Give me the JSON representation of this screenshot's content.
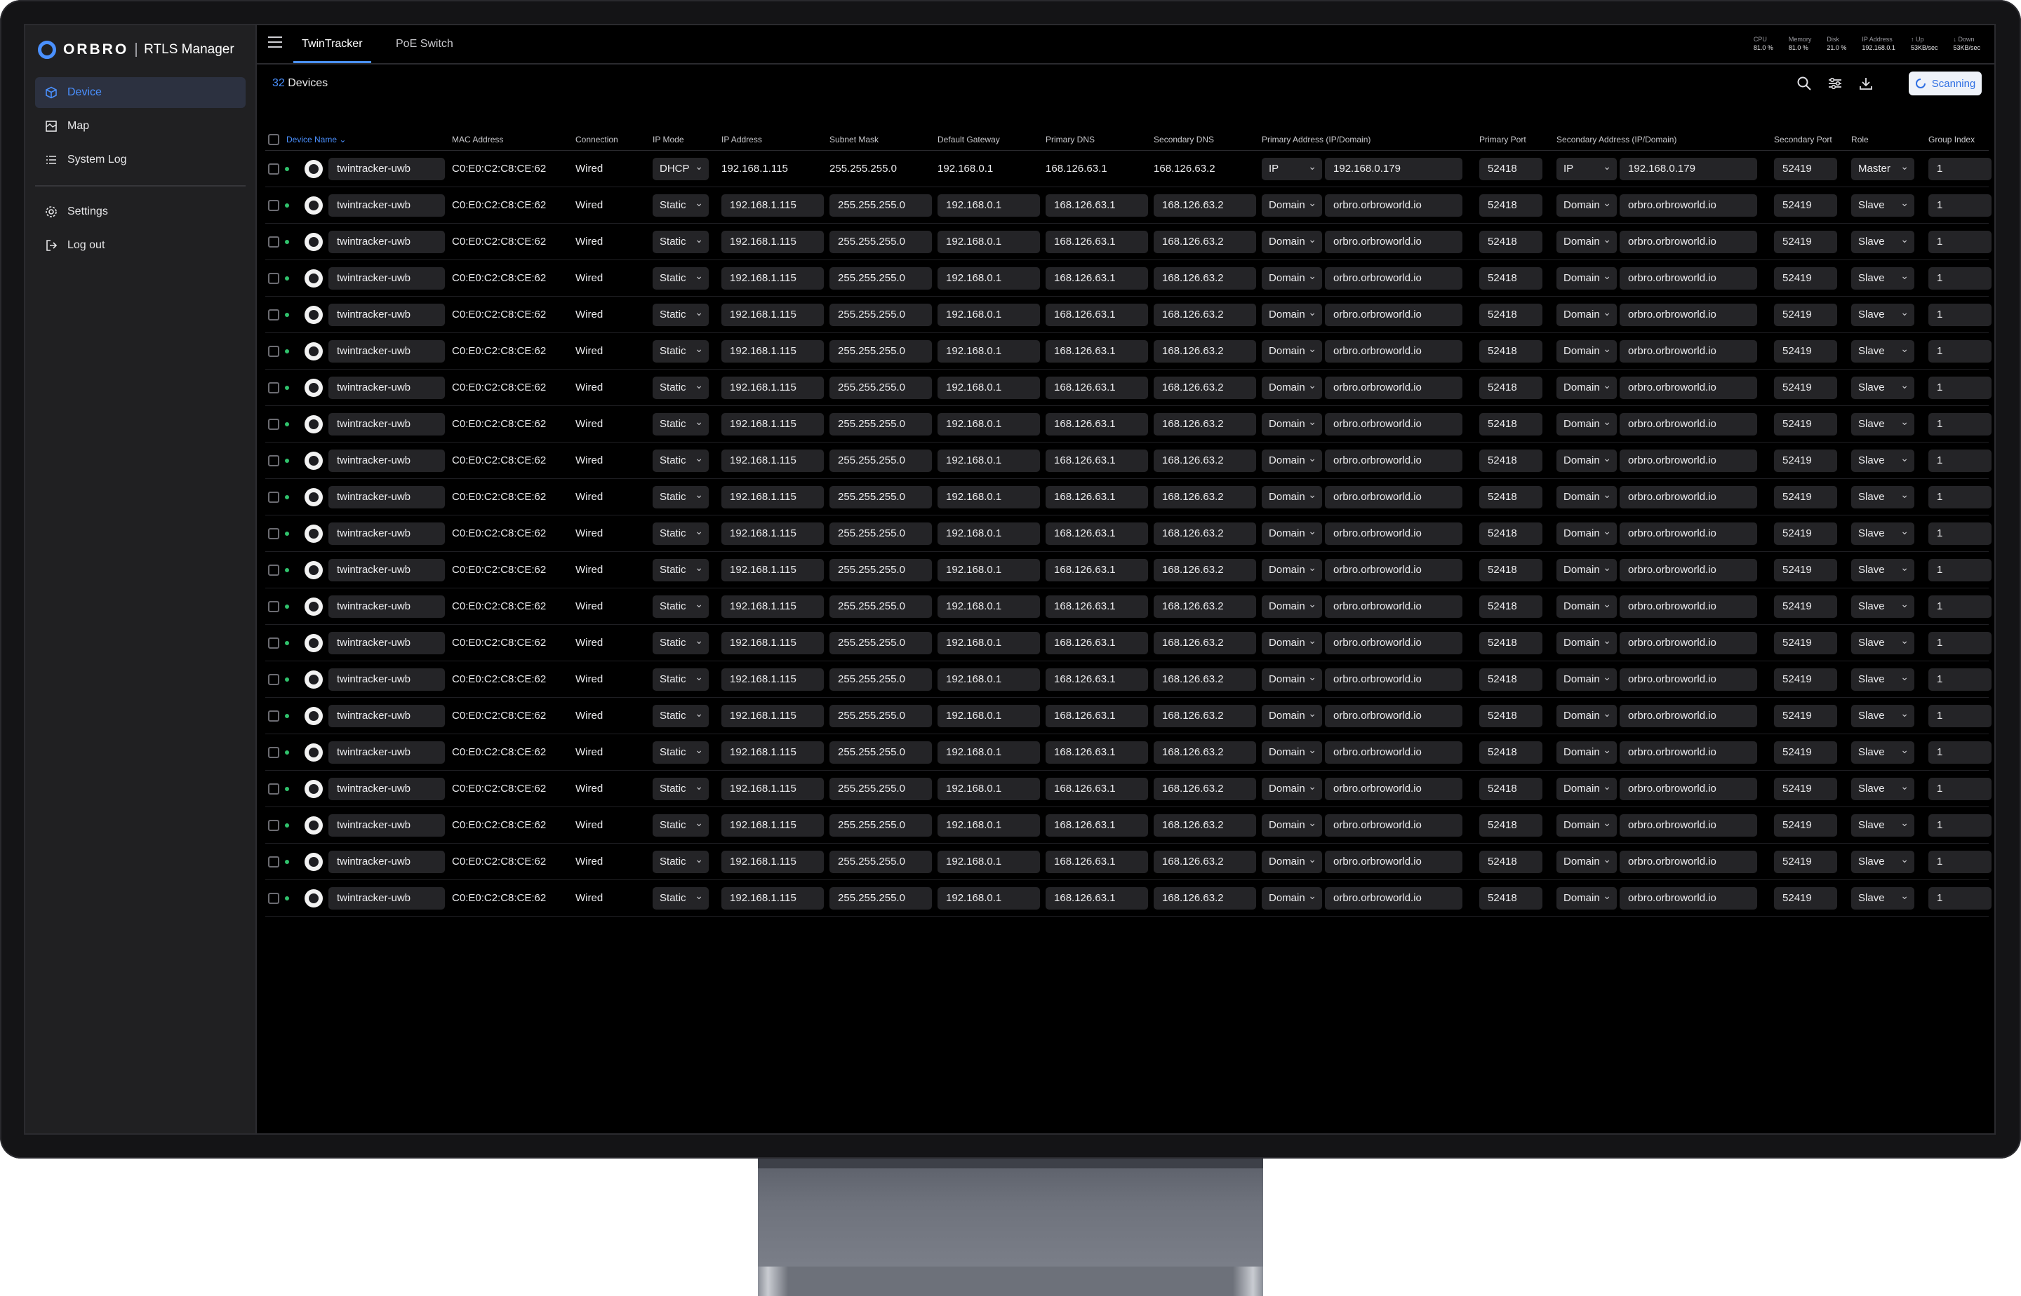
{
  "app": {
    "brand": "ORBRO",
    "product": "RTLS Manager"
  },
  "sidebar": {
    "items": [
      {
        "label": "Device",
        "icon": "cube-icon",
        "active": true
      },
      {
        "label": "Map",
        "icon": "map-icon"
      },
      {
        "label": "System Log",
        "icon": "list-icon"
      }
    ],
    "bottom_items": [
      {
        "label": "Settings",
        "icon": "gear-icon"
      },
      {
        "label": "Log out",
        "icon": "logout-icon"
      }
    ]
  },
  "tabs": [
    {
      "label": "TwinTracker",
      "active": true
    },
    {
      "label": "PoE Switch"
    }
  ],
  "stats": [
    {
      "label": "CPU",
      "value": "81.0 %"
    },
    {
      "label": "Memory",
      "value": "81.0 %"
    },
    {
      "label": "Disk",
      "value": "21.0 %"
    },
    {
      "label": "IP Address",
      "value": "192.168.0.1"
    },
    {
      "label": "↑ Up",
      "value": "53KB/sec"
    },
    {
      "label": "↓ Down",
      "value": "53KB/sec"
    }
  ],
  "toolbar": {
    "count": "32",
    "count_label": "Devices",
    "scan_label": "Scanning"
  },
  "columns": [
    "Device Name",
    "MAC Address",
    "Connection",
    "IP Mode",
    "IP Address",
    "Subnet Mask",
    "Default Gateway",
    "Primary DNS",
    "Secondary DNS",
    "Primary Address (IP/Domain)",
    "Primary Port",
    "Secondary Address (IP/Domain)",
    "Secondary Port",
    "Role",
    "Group Index"
  ],
  "rows": [
    {
      "name": "twintracker-uwb",
      "mac": "C0:E0:C2:C8:CE:62",
      "conn": "Wired",
      "mode": "DHCP",
      "ip": "192.168.1.115",
      "mask": "255.255.255.0",
      "gw": "192.168.0.1",
      "dns1": "168.126.63.1",
      "dns2": "168.126.63.2",
      "paddr_type": "IP",
      "paddr": "192.168.0.179",
      "pport": "52418",
      "saddr_type": "IP",
      "saddr": "192.168.0.179",
      "sport": "52419",
      "role": "Master",
      "group": "1"
    },
    {
      "name": "twintracker-uwb",
      "mac": "C0:E0:C2:C8:CE:62",
      "conn": "Wired",
      "mode": "Static",
      "ip": "192.168.1.115",
      "mask": "255.255.255.0",
      "gw": "192.168.0.1",
      "dns1": "168.126.63.1",
      "dns2": "168.126.63.2",
      "paddr_type": "Domain",
      "paddr": "orbro.orbroworld.io",
      "pport": "52418",
      "saddr_type": "Domain",
      "saddr": "orbro.orbroworld.io",
      "sport": "52419",
      "role": "Slave",
      "group": "1"
    },
    {
      "name": "twintracker-uwb",
      "mac": "C0:E0:C2:C8:CE:62",
      "conn": "Wired",
      "mode": "Static",
      "ip": "192.168.1.115",
      "mask": "255.255.255.0",
      "gw": "192.168.0.1",
      "dns1": "168.126.63.1",
      "dns2": "168.126.63.2",
      "paddr_type": "Domain",
      "paddr": "orbro.orbroworld.io",
      "pport": "52418",
      "saddr_type": "Domain",
      "saddr": "orbro.orbroworld.io",
      "sport": "52419",
      "role": "Slave",
      "group": "1"
    },
    {
      "name": "twintracker-uwb",
      "mac": "C0:E0:C2:C8:CE:62",
      "conn": "Wired",
      "mode": "Static",
      "ip": "192.168.1.115",
      "mask": "255.255.255.0",
      "gw": "192.168.0.1",
      "dns1": "168.126.63.1",
      "dns2": "168.126.63.2",
      "paddr_type": "Domain",
      "paddr": "orbro.orbroworld.io",
      "pport": "52418",
      "saddr_type": "Domain",
      "saddr": "orbro.orbroworld.io",
      "sport": "52419",
      "role": "Slave",
      "group": "1"
    },
    {
      "name": "twintracker-uwb",
      "mac": "C0:E0:C2:C8:CE:62",
      "conn": "Wired",
      "mode": "Static",
      "ip": "192.168.1.115",
      "mask": "255.255.255.0",
      "gw": "192.168.0.1",
      "dns1": "168.126.63.1",
      "dns2": "168.126.63.2",
      "paddr_type": "Domain",
      "paddr": "orbro.orbroworld.io",
      "pport": "52418",
      "saddr_type": "Domain",
      "saddr": "orbro.orbroworld.io",
      "sport": "52419",
      "role": "Slave",
      "group": "1"
    },
    {
      "name": "twintracker-uwb",
      "mac": "C0:E0:C2:C8:CE:62",
      "conn": "Wired",
      "mode": "Static",
      "ip": "192.168.1.115",
      "mask": "255.255.255.0",
      "gw": "192.168.0.1",
      "dns1": "168.126.63.1",
      "dns2": "168.126.63.2",
      "paddr_type": "Domain",
      "paddr": "orbro.orbroworld.io",
      "pport": "52418",
      "saddr_type": "Domain",
      "saddr": "orbro.orbroworld.io",
      "sport": "52419",
      "role": "Slave",
      "group": "1"
    },
    {
      "name": "twintracker-uwb",
      "mac": "C0:E0:C2:C8:CE:62",
      "conn": "Wired",
      "mode": "Static",
      "ip": "192.168.1.115",
      "mask": "255.255.255.0",
      "gw": "192.168.0.1",
      "dns1": "168.126.63.1",
      "dns2": "168.126.63.2",
      "paddr_type": "Domain",
      "paddr": "orbro.orbroworld.io",
      "pport": "52418",
      "saddr_type": "Domain",
      "saddr": "orbro.orbroworld.io",
      "sport": "52419",
      "role": "Slave",
      "group": "1"
    },
    {
      "name": "twintracker-uwb",
      "mac": "C0:E0:C2:C8:CE:62",
      "conn": "Wired",
      "mode": "Static",
      "ip": "192.168.1.115",
      "mask": "255.255.255.0",
      "gw": "192.168.0.1",
      "dns1": "168.126.63.1",
      "dns2": "168.126.63.2",
      "paddr_type": "Domain",
      "paddr": "orbro.orbroworld.io",
      "pport": "52418",
      "saddr_type": "Domain",
      "saddr": "orbro.orbroworld.io",
      "sport": "52419",
      "role": "Slave",
      "group": "1"
    },
    {
      "name": "twintracker-uwb",
      "mac": "C0:E0:C2:C8:CE:62",
      "conn": "Wired",
      "mode": "Static",
      "ip": "192.168.1.115",
      "mask": "255.255.255.0",
      "gw": "192.168.0.1",
      "dns1": "168.126.63.1",
      "dns2": "168.126.63.2",
      "paddr_type": "Domain",
      "paddr": "orbro.orbroworld.io",
      "pport": "52418",
      "saddr_type": "Domain",
      "saddr": "orbro.orbroworld.io",
      "sport": "52419",
      "role": "Slave",
      "group": "1"
    },
    {
      "name": "twintracker-uwb",
      "mac": "C0:E0:C2:C8:CE:62",
      "conn": "Wired",
      "mode": "Static",
      "ip": "192.168.1.115",
      "mask": "255.255.255.0",
      "gw": "192.168.0.1",
      "dns1": "168.126.63.1",
      "dns2": "168.126.63.2",
      "paddr_type": "Domain",
      "paddr": "orbro.orbroworld.io",
      "pport": "52418",
      "saddr_type": "Domain",
      "saddr": "orbro.orbroworld.io",
      "sport": "52419",
      "role": "Slave",
      "group": "1"
    },
    {
      "name": "twintracker-uwb",
      "mac": "C0:E0:C2:C8:CE:62",
      "conn": "Wired",
      "mode": "Static",
      "ip": "192.168.1.115",
      "mask": "255.255.255.0",
      "gw": "192.168.0.1",
      "dns1": "168.126.63.1",
      "dns2": "168.126.63.2",
      "paddr_type": "Domain",
      "paddr": "orbro.orbroworld.io",
      "pport": "52418",
      "saddr_type": "Domain",
      "saddr": "orbro.orbroworld.io",
      "sport": "52419",
      "role": "Slave",
      "group": "1"
    },
    {
      "name": "twintracker-uwb",
      "mac": "C0:E0:C2:C8:CE:62",
      "conn": "Wired",
      "mode": "Static",
      "ip": "192.168.1.115",
      "mask": "255.255.255.0",
      "gw": "192.168.0.1",
      "dns1": "168.126.63.1",
      "dns2": "168.126.63.2",
      "paddr_type": "Domain",
      "paddr": "orbro.orbroworld.io",
      "pport": "52418",
      "saddr_type": "Domain",
      "saddr": "orbro.orbroworld.io",
      "sport": "52419",
      "role": "Slave",
      "group": "1"
    },
    {
      "name": "twintracker-uwb",
      "mac": "C0:E0:C2:C8:CE:62",
      "conn": "Wired",
      "mode": "Static",
      "ip": "192.168.1.115",
      "mask": "255.255.255.0",
      "gw": "192.168.0.1",
      "dns1": "168.126.63.1",
      "dns2": "168.126.63.2",
      "paddr_type": "Domain",
      "paddr": "orbro.orbroworld.io",
      "pport": "52418",
      "saddr_type": "Domain",
      "saddr": "orbro.orbroworld.io",
      "sport": "52419",
      "role": "Slave",
      "group": "1"
    },
    {
      "name": "twintracker-uwb",
      "mac": "C0:E0:C2:C8:CE:62",
      "conn": "Wired",
      "mode": "Static",
      "ip": "192.168.1.115",
      "mask": "255.255.255.0",
      "gw": "192.168.0.1",
      "dns1": "168.126.63.1",
      "dns2": "168.126.63.2",
      "paddr_type": "Domain",
      "paddr": "orbro.orbroworld.io",
      "pport": "52418",
      "saddr_type": "Domain",
      "saddr": "orbro.orbroworld.io",
      "sport": "52419",
      "role": "Slave",
      "group": "1"
    },
    {
      "name": "twintracker-uwb",
      "mac": "C0:E0:C2:C8:CE:62",
      "conn": "Wired",
      "mode": "Static",
      "ip": "192.168.1.115",
      "mask": "255.255.255.0",
      "gw": "192.168.0.1",
      "dns1": "168.126.63.1",
      "dns2": "168.126.63.2",
      "paddr_type": "Domain",
      "paddr": "orbro.orbroworld.io",
      "pport": "52418",
      "saddr_type": "Domain",
      "saddr": "orbro.orbroworld.io",
      "sport": "52419",
      "role": "Slave",
      "group": "1"
    },
    {
      "name": "twintracker-uwb",
      "mac": "C0:E0:C2:C8:CE:62",
      "conn": "Wired",
      "mode": "Static",
      "ip": "192.168.1.115",
      "mask": "255.255.255.0",
      "gw": "192.168.0.1",
      "dns1": "168.126.63.1",
      "dns2": "168.126.63.2",
      "paddr_type": "Domain",
      "paddr": "orbro.orbroworld.io",
      "pport": "52418",
      "saddr_type": "Domain",
      "saddr": "orbro.orbroworld.io",
      "sport": "52419",
      "role": "Slave",
      "group": "1"
    },
    {
      "name": "twintracker-uwb",
      "mac": "C0:E0:C2:C8:CE:62",
      "conn": "Wired",
      "mode": "Static",
      "ip": "192.168.1.115",
      "mask": "255.255.255.0",
      "gw": "192.168.0.1",
      "dns1": "168.126.63.1",
      "dns2": "168.126.63.2",
      "paddr_type": "Domain",
      "paddr": "orbro.orbroworld.io",
      "pport": "52418",
      "saddr_type": "Domain",
      "saddr": "orbro.orbroworld.io",
      "sport": "52419",
      "role": "Slave",
      "group": "1"
    },
    {
      "name": "twintracker-uwb",
      "mac": "C0:E0:C2:C8:CE:62",
      "conn": "Wired",
      "mode": "Static",
      "ip": "192.168.1.115",
      "mask": "255.255.255.0",
      "gw": "192.168.0.1",
      "dns1": "168.126.63.1",
      "dns2": "168.126.63.2",
      "paddr_type": "Domain",
      "paddr": "orbro.orbroworld.io",
      "pport": "52418",
      "saddr_type": "Domain",
      "saddr": "orbro.orbroworld.io",
      "sport": "52419",
      "role": "Slave",
      "group": "1"
    },
    {
      "name": "twintracker-uwb",
      "mac": "C0:E0:C2:C8:CE:62",
      "conn": "Wired",
      "mode": "Static",
      "ip": "192.168.1.115",
      "mask": "255.255.255.0",
      "gw": "192.168.0.1",
      "dns1": "168.126.63.1",
      "dns2": "168.126.63.2",
      "paddr_type": "Domain",
      "paddr": "orbro.orbroworld.io",
      "pport": "52418",
      "saddr_type": "Domain",
      "saddr": "orbro.orbroworld.io",
      "sport": "52419",
      "role": "Slave",
      "group": "1"
    },
    {
      "name": "twintracker-uwb",
      "mac": "C0:E0:C2:C8:CE:62",
      "conn": "Wired",
      "mode": "Static",
      "ip": "192.168.1.115",
      "mask": "255.255.255.0",
      "gw": "192.168.0.1",
      "dns1": "168.126.63.1",
      "dns2": "168.126.63.2",
      "paddr_type": "Domain",
      "paddr": "orbro.orbroworld.io",
      "pport": "52418",
      "saddr_type": "Domain",
      "saddr": "orbro.orbroworld.io",
      "sport": "52419",
      "role": "Slave",
      "group": "1"
    },
    {
      "name": "twintracker-uwb",
      "mac": "C0:E0:C2:C8:CE:62",
      "conn": "Wired",
      "mode": "Static",
      "ip": "192.168.1.115",
      "mask": "255.255.255.0",
      "gw": "192.168.0.1",
      "dns1": "168.126.63.1",
      "dns2": "168.126.63.2",
      "paddr_type": "Domain",
      "paddr": "orbro.orbroworld.io",
      "pport": "52418",
      "saddr_type": "Domain",
      "saddr": "orbro.orbroworld.io",
      "sport": "52419",
      "role": "Slave",
      "group": "1"
    }
  ],
  "colors": {
    "accent": "#4a90ff",
    "status_online": "#30c26c",
    "background": "#000000",
    "sidebar": "#202022",
    "field": "#242427"
  }
}
